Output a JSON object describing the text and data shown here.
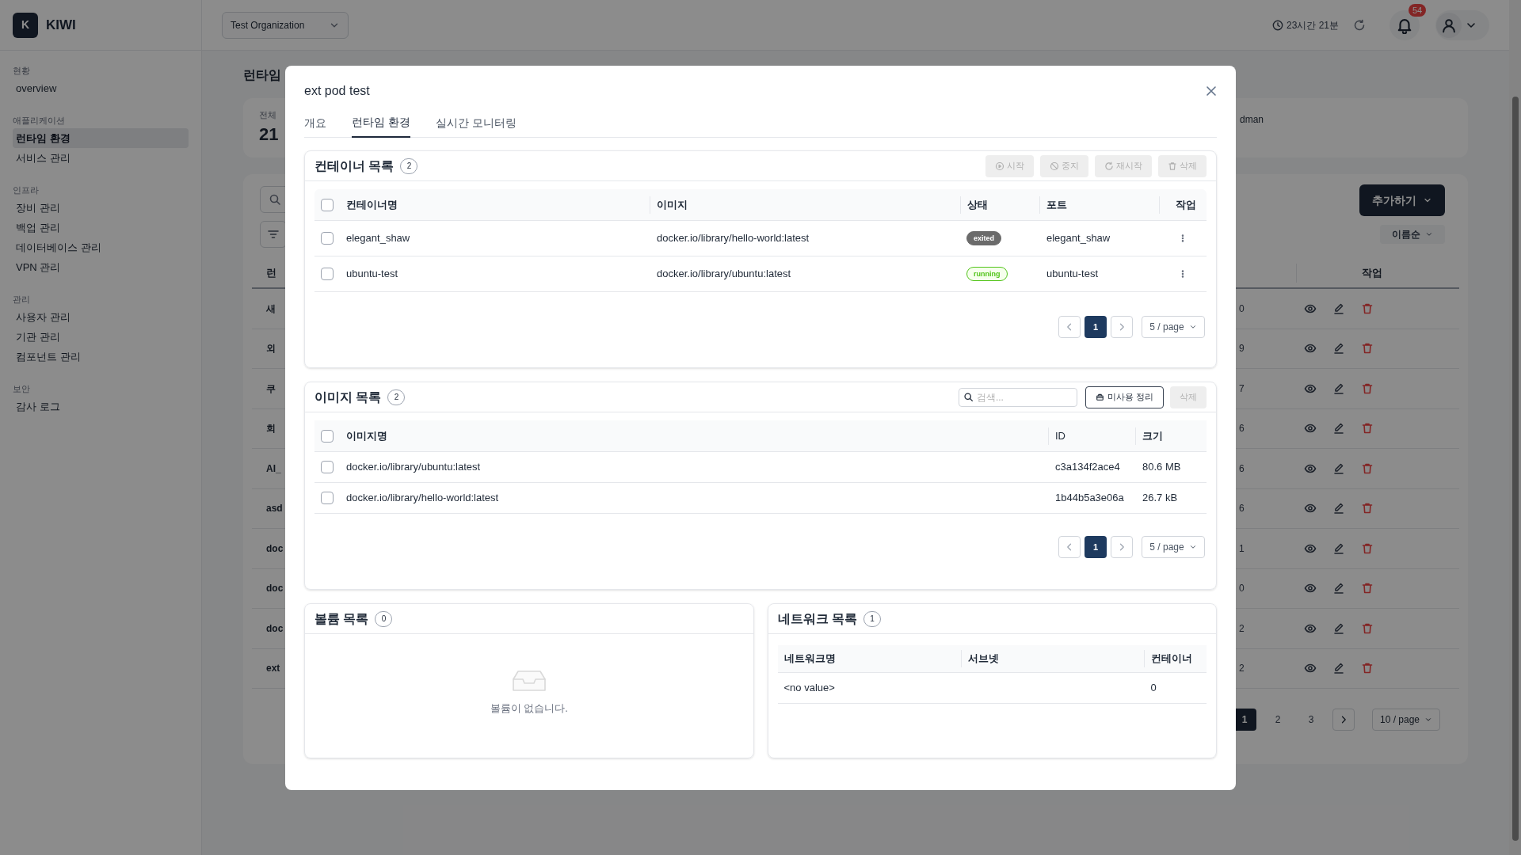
{
  "app": {
    "logo_letter": "K",
    "name": "KIWI"
  },
  "header": {
    "organization": "Test Organization",
    "session_time": "23시간 21분",
    "notification_count": "54"
  },
  "sidebar": {
    "sections": [
      {
        "title": "현황",
        "items": [
          {
            "label": "overview",
            "selected": false
          }
        ]
      },
      {
        "title": "애플리케이션",
        "items": [
          {
            "label": "런타임 환경",
            "selected": true
          },
          {
            "label": "서비스 관리",
            "selected": false
          }
        ]
      },
      {
        "title": "인프라",
        "items": [
          {
            "label": "장비 관리",
            "selected": false
          },
          {
            "label": "백업 관리",
            "selected": false
          },
          {
            "label": "데이터베이스 관리",
            "selected": false
          },
          {
            "label": "VPN 관리",
            "selected": false
          }
        ]
      },
      {
        "title": "관리",
        "items": [
          {
            "label": "사용자 관리",
            "selected": false
          },
          {
            "label": "기관 관리",
            "selected": false
          },
          {
            "label": "컴포넌트 관리",
            "selected": false
          }
        ]
      },
      {
        "title": "보안",
        "items": [
          {
            "label": "감사 로그",
            "selected": false
          }
        ]
      }
    ]
  },
  "page": {
    "title": "런타임",
    "stat": {
      "label": "전체",
      "value": "21"
    },
    "card_text": "dman",
    "add_button": "추가하기",
    "sort": "이름순",
    "table": {
      "columns": [
        "런",
        "작업"
      ],
      "rows": [
        {
          "column_1": "새",
          "column_2": "0"
        },
        {
          "column_1": "외",
          "column_2": "9"
        },
        {
          "column_1": "쿠",
          "column_2": "7"
        },
        {
          "column_1": "회",
          "column_2": "6"
        },
        {
          "column_1": "AI_",
          "column_2": "6"
        },
        {
          "column_1": "asd",
          "column_2": "6"
        },
        {
          "column_1": "doc",
          "column_2": "1"
        },
        {
          "column_1": "doc",
          "column_2": "0"
        },
        {
          "column_1": "doc",
          "column_2": "2"
        },
        {
          "column_1": "ext",
          "column_2": "2"
        }
      ]
    },
    "pagination": {
      "pages": [
        {
          "label": "1",
          "selected": true
        },
        {
          "label": "2",
          "selected": false
        },
        {
          "label": "3",
          "selected": false
        }
      ],
      "page_size": "10 / page"
    }
  },
  "modal": {
    "title": "ext pod test",
    "tabs": [
      {
        "label": "개요",
        "selected": false
      },
      {
        "label": "런타임 환경",
        "selected": true
      },
      {
        "label": "실시간 모니터링",
        "selected": false
      }
    ],
    "containers": {
      "title": "컨테이너 목록",
      "count": "2",
      "actions": [
        {
          "label": "시작",
          "disabled": true
        },
        {
          "label": "중지",
          "disabled": true
        },
        {
          "label": "재시작",
          "disabled": true
        },
        {
          "label": "삭제",
          "disabled": true
        }
      ],
      "all_checked": false,
      "columns": [
        "컨테이너명",
        "이미지",
        "상태",
        "포트",
        "작업"
      ],
      "rows": [
        {
          "checked": false,
          "name": "elegant_shaw",
          "image": "docker.io/library/hello-world:latest",
          "status": "exited",
          "color": "#6b6b6b",
          "port": "elegant_shaw"
        },
        {
          "checked": false,
          "name": "ubuntu-test",
          "image": "docker.io/library/ubuntu:latest",
          "status": "running",
          "color": "#52c41a",
          "port": "ubuntu-test"
        }
      ],
      "pagination": {
        "pages": [
          {
            "label": "1",
            "selected": true
          }
        ],
        "page_size": "5 / page"
      }
    },
    "images": {
      "title": "이미지 목록",
      "count": "2",
      "search": {
        "placeholder": "검색..."
      },
      "actions": [
        {
          "label": "미사용 정리",
          "disabled": false
        },
        {
          "label": "삭제",
          "disabled": true
        }
      ],
      "all_checked": false,
      "columns": [
        "이미지명",
        "ID",
        "크기"
      ],
      "rows": [
        {
          "checked": false,
          "name": "docker.io/library/ubuntu:latest",
          "id": "c3a134f2ace4",
          "size": "80.6 MB"
        },
        {
          "checked": false,
          "name": "docker.io/library/hello-world:latest",
          "id": "1b44b5a3e06a",
          "size": "26.7 kB"
        }
      ],
      "pagination": {
        "pages": [
          {
            "label": "1",
            "selected": true
          }
        ],
        "page_size": "5 / page"
      }
    },
    "volumes": {
      "title": "볼륨 목록",
      "count": "0",
      "empty_text": "볼륨이 없습니다."
    },
    "networks": {
      "title": "네트워크 목록",
      "count": "1",
      "columns": [
        "네트워크명",
        "서브넷",
        "컨테이너"
      ],
      "rows": [
        {
          "name": "<no value>",
          "containers": "0"
        }
      ]
    }
  }
}
